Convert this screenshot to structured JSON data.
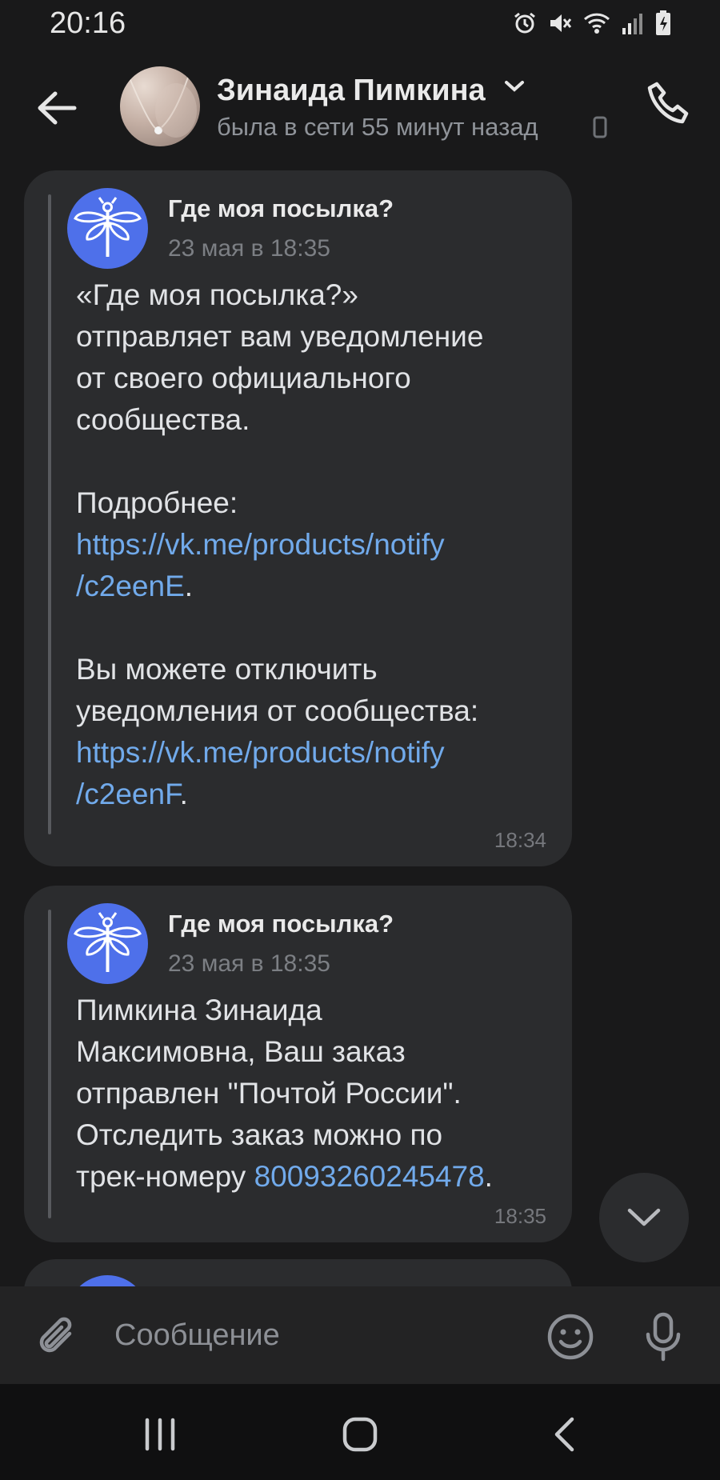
{
  "status_bar": {
    "time": "20:16",
    "icons": [
      "alarm-icon",
      "mute-icon",
      "wifi-icon",
      "signal-icon",
      "battery-charging-icon"
    ]
  },
  "header": {
    "contact_name": "Зинаида Пимкина",
    "last_seen": "была в сети 55 минут назад",
    "icons": [
      "back-arrow-icon",
      "chevron-down-icon",
      "mobile-device-icon",
      "phone-icon"
    ]
  },
  "messages": [
    {
      "forward": {
        "name": "Где моя посылка?",
        "date": "23 мая в 18:35"
      },
      "text_lines": [
        "«Где моя посылка?»",
        "отправляет вам уведомление",
        "от своего официального",
        "сообщества.",
        "",
        "Подробнее:",
        "https://vk.me/products/notify",
        "/c2eenE.",
        "",
        "Вы можете отключить",
        "уведомления от сообщества:",
        "https://vk.me/products/notify",
        "/c2eenF."
      ],
      "link1_a": "https://vk.me/products/notify",
      "link1_b": "/c2eenE",
      "link2_a": "https://vk.me/products/notify",
      "link2_b": "/c2eenF",
      "time": "18:34"
    },
    {
      "forward": {
        "name": "Где моя посылка?",
        "date": "23 мая в 18:35"
      },
      "text_lines": [
        "Пимкина Зинаида",
        "Максимовна, Ваш заказ",
        "отправлен \"Почтой России\".",
        "Отследить заказ можно по",
        "трек-номеру 80093260245478."
      ],
      "track_prefix": "трек-номеру ",
      "track_number": "80093260245478",
      "time": "18:35"
    }
  ],
  "composer": {
    "placeholder": "Сообщение",
    "icons": [
      "paperclip-icon",
      "emoji-icon",
      "microphone-icon"
    ]
  },
  "navigation": {
    "icons": [
      "recent-apps-icon",
      "home-icon",
      "back-icon"
    ]
  },
  "colors": {
    "background": "#19191a",
    "bubble": "#2b2c2e",
    "link": "#71aaeb",
    "community_avatar": "#4e70ea"
  }
}
